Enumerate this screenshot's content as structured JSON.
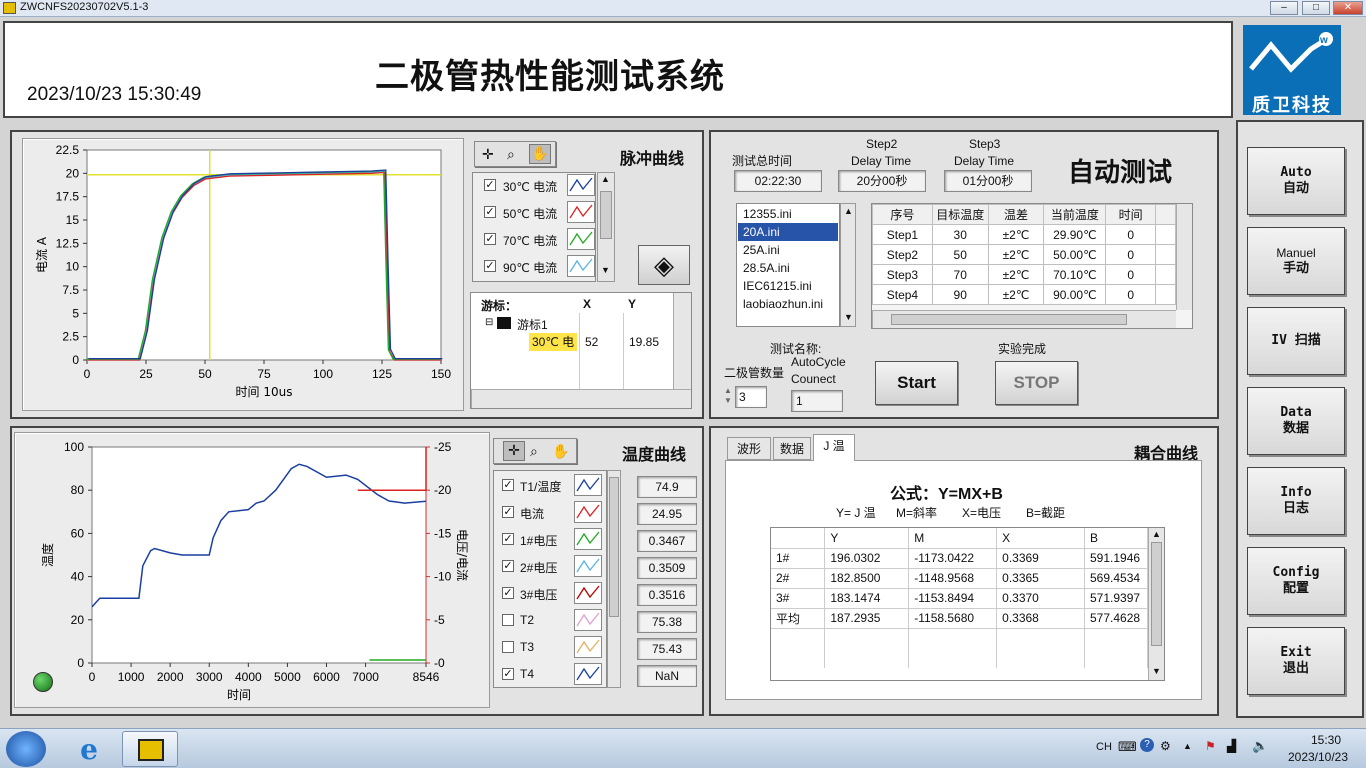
{
  "window": {
    "title": "ZWCNFS20230702V5.1-3",
    "min": "‒",
    "max": "□",
    "close": "✕"
  },
  "header": {
    "title": "二极管热性能测试系统",
    "datetime": "2023/10/23 15:30:49",
    "logo_text": "质卫科技"
  },
  "pulse": {
    "panel_title": "脉冲曲线",
    "ylabel": "电流 A",
    "xlabel": "时间 10us",
    "yticks": [
      "22.5",
      "20",
      "17.5",
      "15",
      "12.5",
      "10",
      "7.5",
      "5",
      "2.5",
      "0"
    ],
    "xticks": [
      "0",
      "25",
      "50",
      "75",
      "100",
      "125",
      "150"
    ],
    "legend": [
      {
        "label": "30℃ 电流",
        "checked": true,
        "color": "#1a3fa0"
      },
      {
        "label": "50℃ 电流",
        "checked": true,
        "color": "#d22"
      },
      {
        "label": "70℃ 电流",
        "checked": true,
        "color": "#2a2"
      },
      {
        "label": "90℃ 电流",
        "checked": true,
        "color": "#5ab4e8"
      }
    ],
    "cursor": {
      "h_label": "游标：",
      "h_x": "X",
      "h_y": "Y",
      "name": "游标1",
      "series": "30℃ 电",
      "x": "52",
      "y": "19.85"
    },
    "chart_data": {
      "type": "line",
      "xlabel": "时间 10us",
      "ylabel": "电流 A",
      "xlim": [
        0,
        150
      ],
      "ylim": [
        0,
        22.5
      ],
      "series": [
        {
          "name": "30℃ 电流",
          "x": [
            0,
            22,
            25,
            28,
            32,
            36,
            40,
            45,
            50,
            60,
            80,
            100,
            120,
            126,
            127,
            128,
            130,
            150
          ],
          "y": [
            0,
            0,
            3,
            8.5,
            13,
            15.8,
            17.5,
            18.8,
            19.5,
            19.8,
            19.9,
            20,
            20.1,
            20.2,
            10,
            1,
            0,
            0
          ]
        }
      ],
      "cursor": {
        "x": 52,
        "y": 19.85
      }
    }
  },
  "temp": {
    "panel_title": "温度曲线",
    "ylabel_left": "温度",
    "ylabel_right": "电压/电流",
    "xlabel": "时间",
    "yticks_left": [
      "100",
      "80",
      "60",
      "40",
      "20",
      "0"
    ],
    "yticks_right": [
      "25",
      "20",
      "15",
      "10",
      "5",
      "0"
    ],
    "xticks": [
      "0",
      "1000",
      "2000",
      "3000",
      "4000",
      "5000",
      "6000",
      "7000",
      "8546"
    ],
    "legend": [
      {
        "label": "T1/温度",
        "checked": true,
        "color": "#1a3fa0",
        "value": "74.9"
      },
      {
        "label": "电流",
        "checked": true,
        "color": "#d22",
        "value": "24.95"
      },
      {
        "label": "1#电压",
        "checked": true,
        "color": "#2a2",
        "value": "0.3467"
      },
      {
        "label": "2#电压",
        "checked": true,
        "color": "#5ab4e8",
        "value": "0.3509"
      },
      {
        "label": "3#电压",
        "checked": true,
        "color": "#b00",
        "value": "0.3516"
      },
      {
        "label": "T2",
        "checked": false,
        "color": "#e0a0d0",
        "value": "75.38"
      },
      {
        "label": "T3",
        "checked": false,
        "color": "#e8b060",
        "value": "75.43"
      },
      {
        "label": "T4",
        "checked": true,
        "color": "#1a3fa0",
        "value": "NaN"
      }
    ],
    "chart_data": {
      "type": "line",
      "xlabel": "时间",
      "ylabel": "温度",
      "xlim": [
        0,
        8546
      ],
      "ylim": [
        0,
        100
      ],
      "y2lim": [
        0,
        25
      ],
      "series": [
        {
          "name": "T1/温度",
          "x": [
            0,
            100,
            200,
            600,
            1200,
            1300,
            1500,
            1600,
            2000,
            2300,
            3000,
            3100,
            3300,
            3500,
            4000,
            4200,
            4400,
            4700,
            5100,
            5300,
            5500,
            6000,
            6500,
            6800,
            7300,
            7600,
            8000,
            8546
          ],
          "y": [
            26,
            28,
            30,
            30,
            30,
            45,
            52,
            53,
            51,
            50,
            50,
            58,
            66,
            70,
            71,
            74,
            75,
            80,
            90,
            92,
            91,
            86,
            87,
            85,
            78,
            75,
            74,
            74.9
          ]
        },
        {
          "name": "电流",
          "x": [
            6800,
            8546,
            8546
          ],
          "y": [
            20,
            20,
            25
          ],
          "axis": "right"
        },
        {
          "name": "1#电压",
          "x": [
            7100,
            8546
          ],
          "y": [
            0.35,
            0.35
          ],
          "axis": "right"
        }
      ]
    }
  },
  "auto": {
    "panel_title": "自动测试",
    "total_time_label": "测试总时间",
    "total_time": "02:22:30",
    "step2_label1": "Step2",
    "step2_label2": "Delay Time",
    "step2_value": "20分00秒",
    "step3_label1": "Step3",
    "step3_label2": "Delay Time",
    "step3_value": "01分00秒",
    "files": [
      "12355.ini",
      "20A.ini",
      "25A.ini",
      "28.5A.ini",
      "IEC61215.ini",
      "laobiaozhun.ini"
    ],
    "selected_file": "20A.ini",
    "table_headers": [
      "序号",
      "目标温度",
      "温差",
      "当前温度",
      "时间",
      ""
    ],
    "table_rows": [
      [
        "Step1",
        "30",
        "±2℃",
        "29.90℃",
        "0"
      ],
      [
        "Step2",
        "50",
        "±2℃",
        "50.00℃",
        "0"
      ],
      [
        "Step3",
        "70",
        "±2℃",
        "70.10℃",
        "0"
      ],
      [
        "Step4",
        "90",
        "±2℃",
        "90.00℃",
        "0"
      ]
    ],
    "test_name_label": "测试名称:",
    "diode_count_label": "二极管数量",
    "diode_count": "3",
    "autocycle_label1": "AutoCycle",
    "autocycle_label2": "Counect",
    "autocycle_value": "1",
    "done_label": "实验完成",
    "start": "Start",
    "stop": "STOP"
  },
  "fit": {
    "panel_title": "耦合曲线",
    "tabs": [
      "波形",
      "数据",
      "J 温"
    ],
    "formula": "公式：Y=MX+B",
    "legend_line": [
      "Y= J 温",
      "M=斜率",
      "X=电压",
      "B=截距"
    ],
    "headers": [
      "",
      "Y",
      "M",
      "X",
      "B"
    ],
    "rows": [
      [
        "1#",
        "196.0302",
        "-1173.0422",
        "0.3369",
        "591.1946"
      ],
      [
        "2#",
        "182.8500",
        "-1148.9568",
        "0.3365",
        "569.4534"
      ],
      [
        "3#",
        "183.1474",
        "-1153.8494",
        "0.3370",
        "571.9397"
      ],
      [
        "平均",
        "187.2935",
        "-1158.5680",
        "0.3368",
        "577.4628"
      ]
    ]
  },
  "side": [
    {
      "en": "Auto",
      "zh": "自动"
    },
    {
      "en": "Manuel",
      "zh": "手动"
    },
    {
      "en": "IV 扫描",
      "zh": ""
    },
    {
      "en": "Data",
      "zh": "数据"
    },
    {
      "en": "Info",
      "zh": "日志"
    },
    {
      "en": "Config",
      "zh": "配置"
    },
    {
      "en": "Exit",
      "zh": "退出"
    }
  ],
  "taskbar": {
    "lang": "CH",
    "time": "15:30",
    "date": "2023/10/23"
  }
}
